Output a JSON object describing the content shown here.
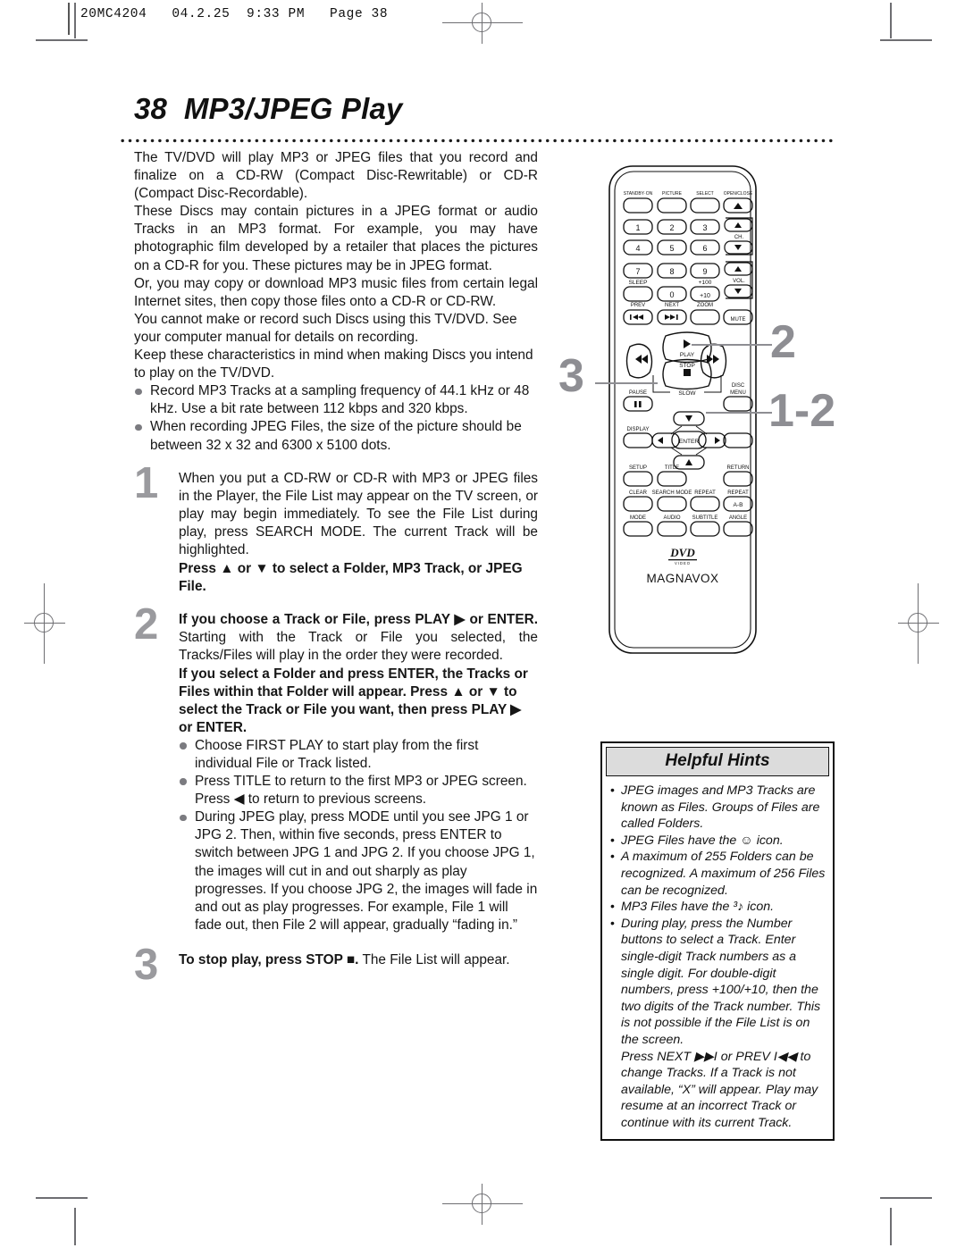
{
  "print_slug": "20MC4204   04.2.25  9:33 PM   Page 38",
  "page": {
    "number": "38",
    "title": "MP3/JPEG Play"
  },
  "intro": {
    "paragraphs": [
      "The TV/DVD will play MP3 or JPEG files that you record and finalize on a CD-RW (Compact Disc-Rewritable) or CD-R (Compact Disc-Recordable).",
      "These Discs may contain pictures in a JPEG format or audio Tracks in an MP3 format. For example, you may have photographic film developed by a retailer that places the pictures on a CD-R for you. These pictures may be in JPEG format.",
      "Or, you may copy or download MP3 music files from certain legal Internet sites, then copy those files onto a CD-R or CD-RW.",
      "You cannot make or record such Discs using this TV/DVD. See your computer manual for details on recording.",
      "Keep these characteristics in mind when making Discs you intend to play on the TV/DVD."
    ],
    "bullets": [
      "Record MP3 Tracks at a sampling frequency of 44.1 kHz or 48 kHz. Use a bit rate between 112 kbps and 320 kbps.",
      "When recording JPEG Files, the size of the picture should be between 32 x 32 and 6300 x 5100 dots."
    ]
  },
  "steps": [
    {
      "number": "1",
      "plain": "When you put a CD-RW or CD-R with MP3 or JPEG files in the Player, the File List may appear on the TV screen, or play may begin immediately. To see the File List during play, press SEARCH MODE. The current Track will be highlighted.",
      "bold": "Press ▲ or ▼ to select a Folder, MP3 Track, or JPEG File."
    },
    {
      "number": "2",
      "bold_lead": "If you choose a Track or File, press PLAY ▶ or ENTER.",
      "plain": "Starting with the Track or File you selected, the Tracks/Files will play in the order they were recorded.",
      "bold_tail": "If you select a Folder and press ENTER, the Tracks or Files within that Folder will appear. Press ▲ or ▼ to select the Track or File you want, then press PLAY ▶ or ENTER.",
      "bullets": [
        "Choose FIRST PLAY to start play from the first individual File or Track listed.",
        "Press TITLE to return to the first MP3 or JPEG screen. Press ◀ to return to previous screens.",
        "During JPEG play, press MODE until you see JPG 1 or JPG 2. Then, within five seconds, press ENTER to switch between JPG 1 and JPG 2. If you choose JPG 1, the images will cut in and out sharply as play progresses. If you choose JPG 2, the images will fade in and out as play progresses. For example, File 1 will fade out, then File 2 will appear, gradually “fading in.”"
      ]
    },
    {
      "number": "3",
      "bold_lead": "To stop play, press STOP ■.",
      "plain": "The File List will appear."
    }
  ],
  "hints": {
    "heading": "Helpful Hints",
    "items": [
      "JPEG images and MP3 Tracks are known as Files. Groups of Files are called Folders.",
      "JPEG Files have the ☺ icon.",
      "A maximum of 255 Folders can be recognized. A maximum of 256 Files can be recognized.",
      "MP3 Files have the ³♪ icon.",
      "During play, press the Number buttons to select a Track. Enter single-digit Track numbers as a single digit. For double-digit numbers, press +100/+10, then the two digits of the Track number. This is not possible if the File List is on the screen."
    ],
    "items_continued": [
      "Press NEXT ▶▶I or PREV I◀◀ to change Tracks. If a Track is not available, “X” will appear. Play may resume at an incorrect Track or continue with its current Track."
    ]
  },
  "remote": {
    "brand": "MAGNAVOX",
    "logo": "DVD",
    "logo_sub": "VIDEO",
    "row_top": [
      "STANDBY·ON",
      "PICTURE",
      "SELECT",
      "OPEN/CLOSE"
    ],
    "numbers": [
      "1",
      "2",
      "3",
      "4",
      "5",
      "6",
      "7",
      "8",
      "9",
      "0"
    ],
    "plus100": "+100",
    "plus10": "+10",
    "ch_label": "CH.",
    "vol_label": "VOL.",
    "sleep": "SLEEP",
    "prev": "PREV",
    "next": "NEXT",
    "zoom": "ZOOM",
    "mute": "MUTE",
    "play": "PLAY",
    "stop": "STOP",
    "slow": "SLOW",
    "pause": "PAUSE",
    "disc_menu_1": "DISC",
    "disc_menu_2": "MENU",
    "display": "DISPLAY",
    "enter": "ENTER",
    "setup": "SETUP",
    "title_btn": "TITLE",
    "return_btn": "RETURN",
    "clear": "CLEAR",
    "search_mode": "SEARCH MODE",
    "repeat": "REPEAT",
    "repeat_ab_label": "REPEAT",
    "repeat_ab": "A-B",
    "mode": "MODE",
    "audio": "AUDIO",
    "subtitle": "SUBTITLE",
    "angle": "ANGLE"
  },
  "callouts": [
    {
      "label": "2"
    },
    {
      "label": "3"
    },
    {
      "label": "1-2"
    }
  ],
  "colors": {
    "step_number": "#9a9a9e",
    "callout": "#8e8e93",
    "bullet_dot": "#7b7b80",
    "hint_header_bg": "#dcdcdc",
    "rule": "#6e6e72"
  }
}
